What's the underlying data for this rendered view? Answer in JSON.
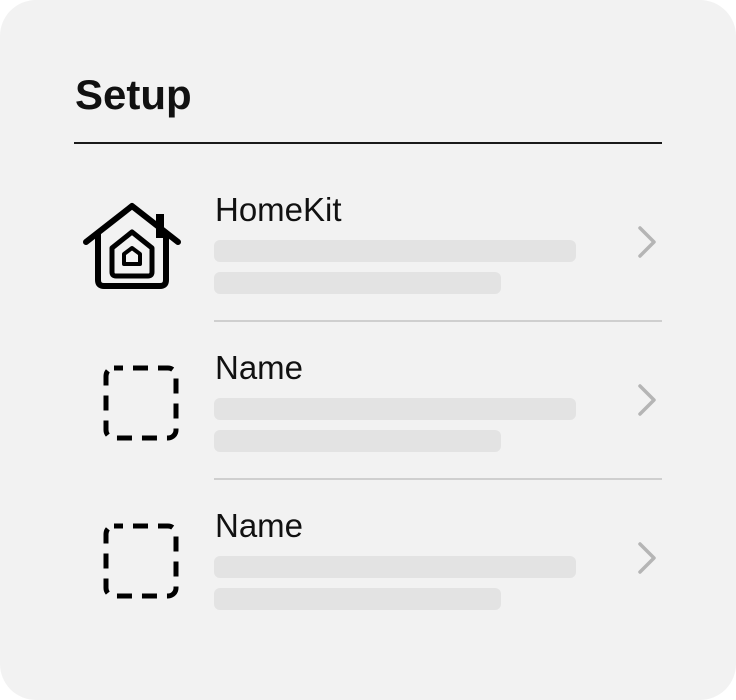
{
  "setup": {
    "title": "Setup",
    "items": [
      {
        "label": "HomeKit",
        "icon": "homekit-house-icon"
      },
      {
        "label": "Name",
        "icon": "placeholder-dashed-square-icon"
      },
      {
        "label": "Name",
        "icon": "placeholder-dashed-square-icon"
      }
    ]
  },
  "colors": {
    "background": "#f2f2f2",
    "skeleton": "#e3e3e3",
    "chevron": "#b5b5b5",
    "divider": "#cfcfcf",
    "text": "#111111"
  }
}
